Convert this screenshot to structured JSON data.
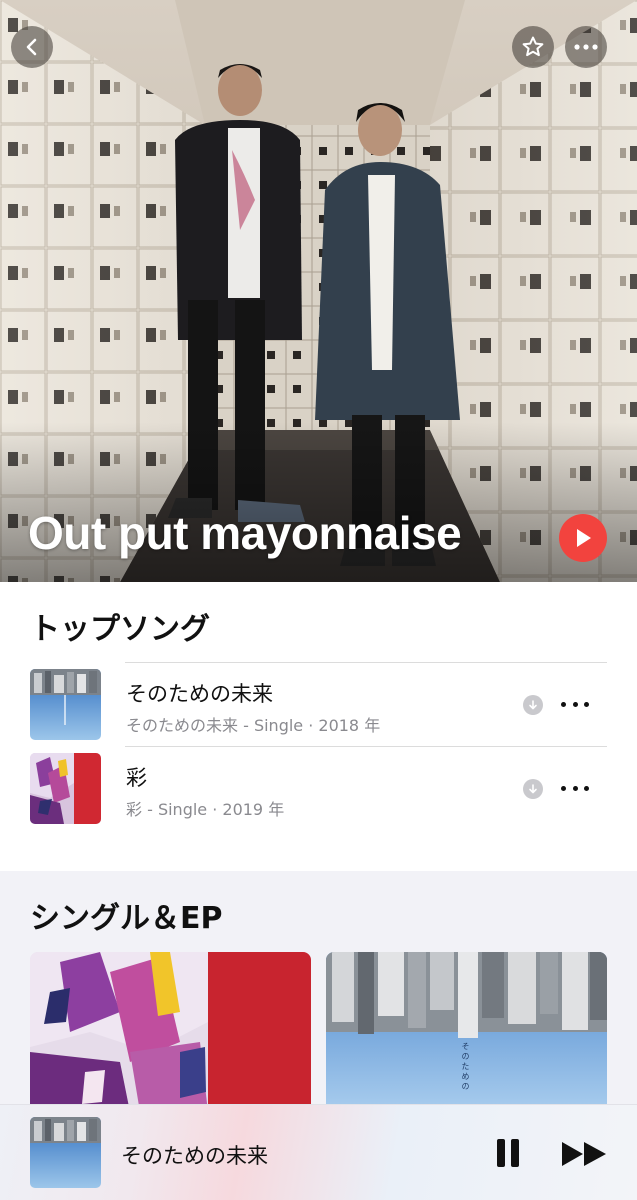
{
  "header": {
    "artist_name": "Out put mayonnaise",
    "back_icon": "chevron-left-icon",
    "favorite_icon": "star-icon",
    "more_icon": "ellipsis-icon",
    "play_icon": "play-icon",
    "accent_color": "#f2433e"
  },
  "top_songs": {
    "title": "トップソング",
    "items": [
      {
        "title": "そのための未来",
        "subtitle": "そのための未来 - Single · 2018 年",
        "download_icon": "download-icon",
        "more_icon": "ellipsis-icon"
      },
      {
        "title": "彩",
        "subtitle": "彩 - Single · 2019 年",
        "download_icon": "download-icon",
        "more_icon": "ellipsis-icon"
      }
    ]
  },
  "singles": {
    "title": "シングル＆EP",
    "cover_text_b": "そのための"
  },
  "now_playing": {
    "title": "そのための未来",
    "pause_icon": "pause-icon",
    "forward_icon": "fast-forward-icon"
  }
}
